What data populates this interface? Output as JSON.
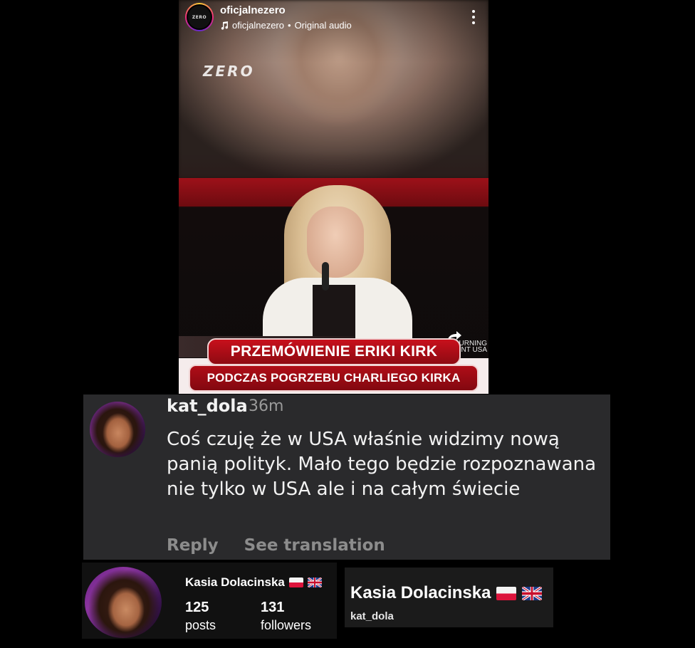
{
  "reel": {
    "username": "oficjalnezero",
    "audio_owner": "oficjalnezero",
    "audio_separator": " • ",
    "audio_label": "Original audio",
    "avatar_text": "ZERO",
    "watermark": "ZERO",
    "banner_line1": "PRZEMÓWIENIE ERIKI KIRK",
    "banner_line2": "PODCZAS POGRZEBU CHARLIEGO KIRKA",
    "corner_label_line1": "URNING",
    "corner_label_line2": "OINT USA",
    "icons": [
      "music-icon",
      "more-icon",
      "share-icon"
    ]
  },
  "comment": {
    "username": "kat_dola",
    "time": "36m",
    "text": "Coś czuję że w USA właśnie widzimy nową panią polityk. Mało tego będzie rozpoznawana nie tylko w USA ale i na całym świecie",
    "reply_label": "Reply",
    "translate_label": "See translation"
  },
  "profile": {
    "name": "Kasia Dolacinska",
    "posts_count": "125",
    "posts_label": "posts",
    "followers_count": "131",
    "followers_label": "followers",
    "flags": [
      "poland-flag-icon",
      "uk-flag-icon"
    ]
  },
  "namecard": {
    "name": "Kasia Dolacinska",
    "handle": "kat_dola"
  },
  "colors": {
    "comment_bg": "#2a2a2c",
    "muted_text": "#8c8c8c",
    "banner_red": "#c8101c"
  }
}
